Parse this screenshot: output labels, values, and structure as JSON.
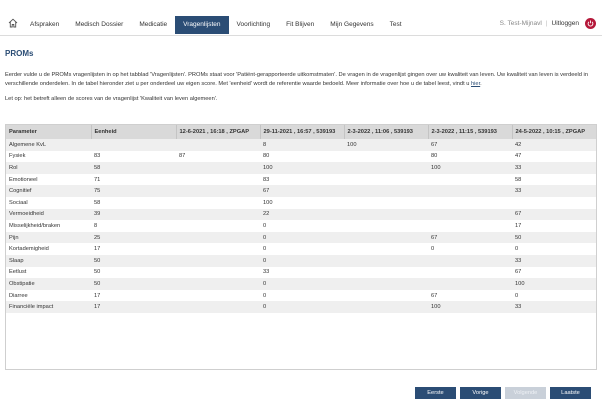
{
  "nav": {
    "tabs": [
      "Afspraken",
      "Medisch Dossier",
      "Medicatie",
      "Vragenlijsten",
      "Voorlichting",
      "Fit Blijven",
      "Mijn Gegevens",
      "Test"
    ],
    "active_tab": "Vragenlijsten",
    "user_name": "S. Test-Mijnavl",
    "separator": "|",
    "logout_label": "Uitloggen"
  },
  "page": {
    "title": "PROMs",
    "intro_text": "Eerder vulde u de PROMs vragenlijsten in op het tabblad 'Vragenlijsten'. PROMs staat voor 'Patiënt-gerapporteerde uitkomstmaten'. De vragen in de vragenlijst gingen over uw kwaliteit van leven. Uw kwaliteit van leven is verdeeld in verschillende onderdelen. In de tabel hieronder ziet u per onderdeel uw eigen score. Met 'eenheid' wordt de referentie waarde bedoeld. Meer informatie over hoe u de tabel leest, vindt u ",
    "intro_link": "hier",
    "intro_end": ".",
    "note": "Let op: het betreft alleen de scores van de vragenlijst 'Kwaliteit van leven algemeen'."
  },
  "table": {
    "headers": [
      "Parameter",
      "Eenheid",
      "12-6-2021 , 16:18 , ZPGAP",
      "29-11-2021 , 16:57 , 539193",
      "2-3-2022 , 11:06 , 539193",
      "2-3-2022 , 11:15 , 539193",
      "24-5-2022 , 10:15 , ZPGAP"
    ],
    "rows": [
      [
        "Algemene KvL",
        "",
        "",
        "8",
        "100",
        "67",
        "42"
      ],
      [
        "Fysiek",
        "83",
        "87",
        "80",
        "",
        "80",
        "47"
      ],
      [
        "Rol",
        "58",
        "",
        "100",
        "",
        "100",
        "33"
      ],
      [
        "Emotioneel",
        "71",
        "",
        "83",
        "",
        "",
        "58"
      ],
      [
        "Cognitief",
        "75",
        "",
        "67",
        "",
        "",
        "33"
      ],
      [
        "Sociaal",
        "58",
        "",
        "100",
        "",
        "",
        ""
      ],
      [
        "Vermoeidheid",
        "39",
        "",
        "22",
        "",
        "",
        "67"
      ],
      [
        "Misselijkheid/braken",
        "8",
        "",
        "0",
        "",
        "",
        "17"
      ],
      [
        "Pijn",
        "25",
        "",
        "0",
        "",
        "67",
        "50"
      ],
      [
        "Kortademigheid",
        "17",
        "",
        "0",
        "",
        "0",
        "0"
      ],
      [
        "Slaap",
        "50",
        "",
        "0",
        "",
        "",
        "33"
      ],
      [
        "Eetlust",
        "50",
        "",
        "33",
        "",
        "",
        "67"
      ],
      [
        "Obstipatie",
        "50",
        "",
        "0",
        "",
        "",
        "100"
      ],
      [
        "Diarree",
        "17",
        "",
        "0",
        "",
        "67",
        "0"
      ],
      [
        "Financiële impact",
        "17",
        "",
        "0",
        "",
        "100",
        "33"
      ]
    ]
  },
  "pager": {
    "first": "Eerste",
    "prev": "Vorige",
    "next": "Volgende",
    "last": "Laatste"
  }
}
